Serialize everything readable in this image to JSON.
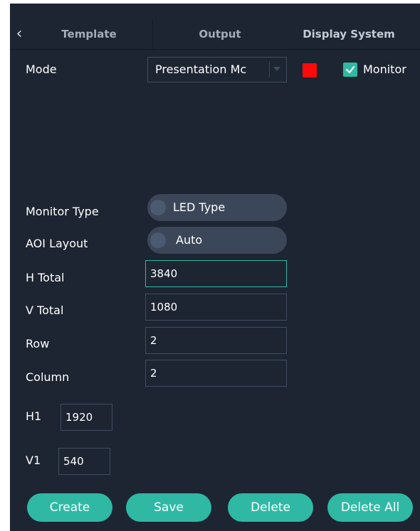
{
  "tabs": {
    "back_icon": "chevron-left-icon",
    "items": [
      {
        "label": "Template"
      },
      {
        "label": "Output"
      },
      {
        "label": "Display System"
      }
    ]
  },
  "mode": {
    "label": "Mode",
    "value": "Presentation Mc",
    "color_swatch": "#ff0a0a",
    "monitor_checked": true,
    "monitor_label": "Monitor"
  },
  "monitor_type": {
    "label": "Monitor Type",
    "value": "LED Type"
  },
  "aoi_layout": {
    "label": "AOI Layout",
    "value": "Auto"
  },
  "fields": {
    "h_total": {
      "label": "H Total",
      "value": "3840"
    },
    "v_total": {
      "label": "V Total",
      "value": "1080"
    },
    "row": {
      "label": "Row",
      "value": "2"
    },
    "column": {
      "label": "Column",
      "value": "2"
    },
    "h1": {
      "label": "H1",
      "value": "1920"
    },
    "v1": {
      "label": "V1",
      "value": "540"
    }
  },
  "buttons": {
    "create": "Create",
    "save": "Save",
    "delete": "Delete",
    "delete_all": "Delete All"
  },
  "colors": {
    "background": "#1d2532",
    "accent": "#2fb9a5",
    "toggle_bg": "#3b4759"
  }
}
